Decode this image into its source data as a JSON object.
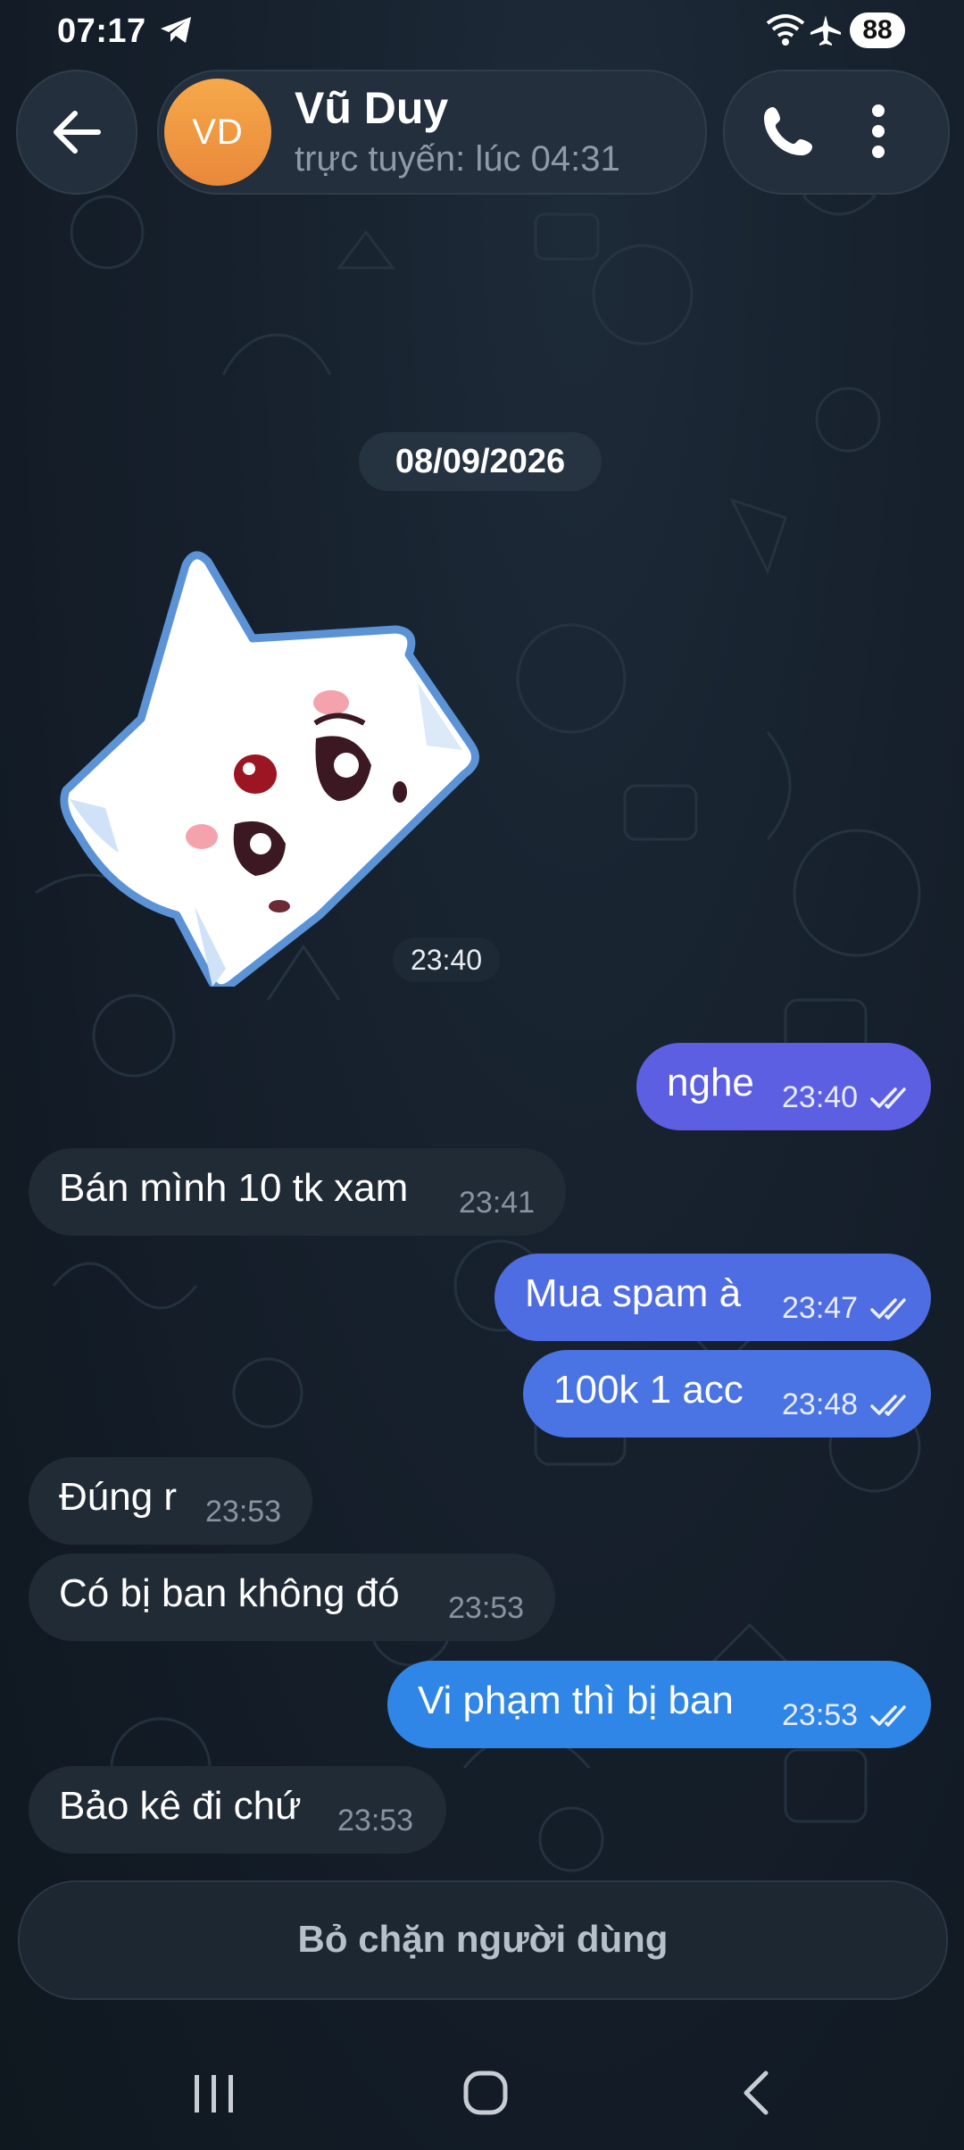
{
  "status_bar": {
    "time": "07:17",
    "battery": "88"
  },
  "header": {
    "avatar_initials": "VD",
    "contact_name": "Vũ Duy",
    "contact_status": "trực tuyến: lúc 04:31"
  },
  "chat": {
    "date_separator": "08/09/2026",
    "sticker_time": "23:40",
    "messages": [
      {
        "direction": "out",
        "text": "nghe",
        "time": "23:40"
      },
      {
        "direction": "in",
        "text": "Bán mình 10 tk xam",
        "time": "23:41"
      },
      {
        "direction": "out",
        "text": "Mua spam à",
        "time": "23:47"
      },
      {
        "direction": "out",
        "text": "100k 1 acc",
        "time": "23:48"
      },
      {
        "direction": "in",
        "text": "Đúng r",
        "time": "23:53"
      },
      {
        "direction": "in",
        "text": "Có bị ban không đó",
        "time": "23:53"
      },
      {
        "direction": "out",
        "text": "Vi phạm thì bị ban",
        "time": "23:53"
      },
      {
        "direction": "in",
        "text": "Bảo kê đi chứ",
        "time": "23:53"
      }
    ]
  },
  "footer": {
    "unblock_label": "Bỏ chặn người dùng"
  },
  "colors": {
    "background": "#16202c",
    "incoming_bubble": "#212b36",
    "outgoing_bubble_top": "#6a5ee0",
    "outgoing_bubble_bottom": "#2f86e6",
    "avatar": "#f0973f"
  },
  "icons": {
    "status": [
      "telegram-icon",
      "wifi-icon",
      "airplane-icon"
    ],
    "header": [
      "back-arrow-icon",
      "phone-icon",
      "more-vertical-icon"
    ],
    "message_status": "double-check-icon",
    "nav": [
      "recent-apps-icon",
      "home-icon",
      "back-icon"
    ]
  }
}
